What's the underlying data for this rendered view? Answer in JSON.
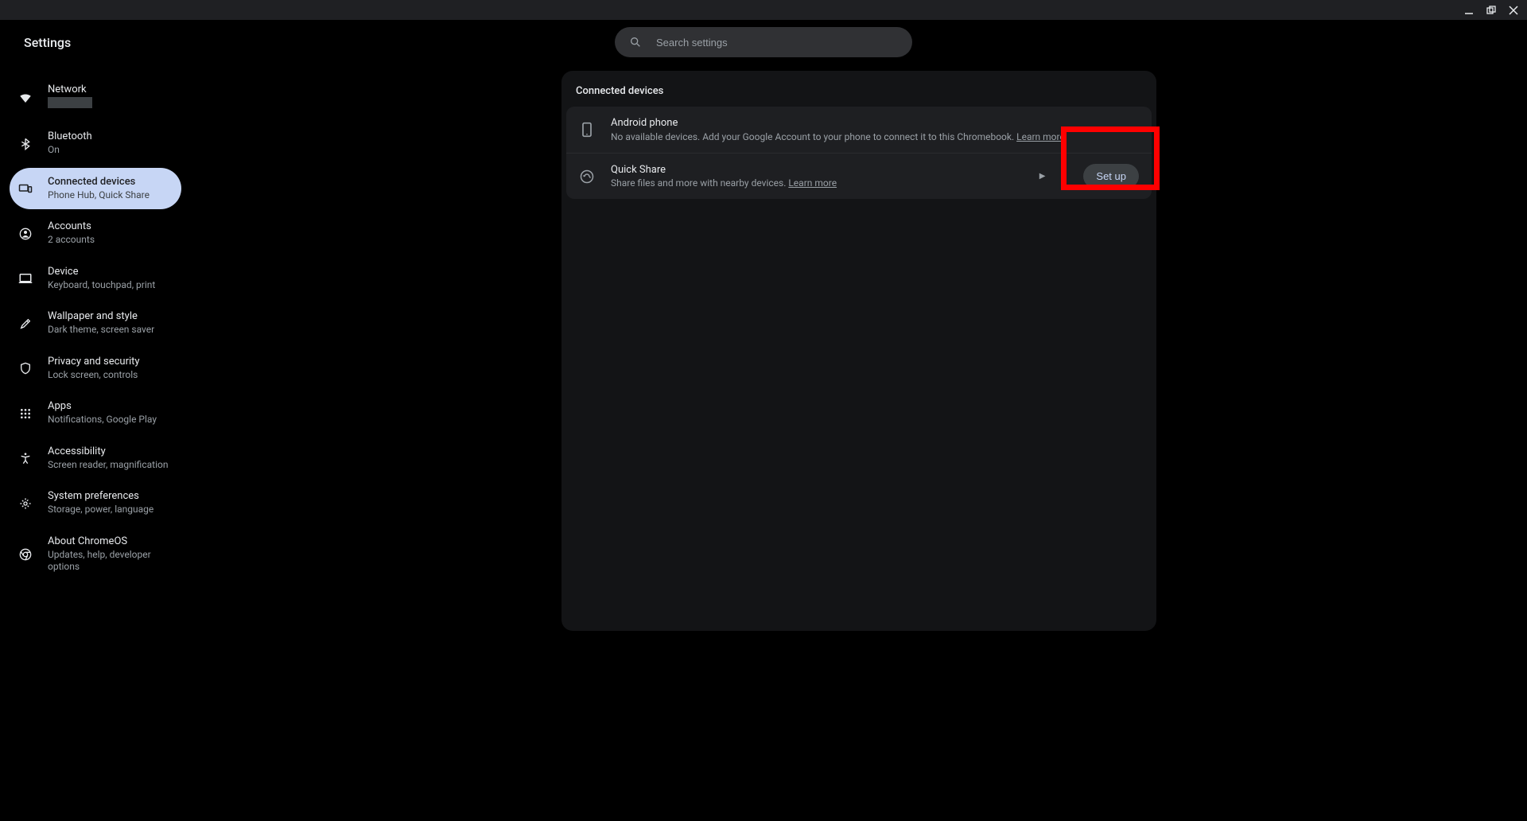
{
  "window": {
    "app_title": "Settings"
  },
  "search": {
    "placeholder": "Search settings"
  },
  "sidebar": {
    "items": [
      {
        "label": "Network",
        "sublabel": ""
      },
      {
        "label": "Bluetooth",
        "sublabel": "On"
      },
      {
        "label": "Connected devices",
        "sublabel": "Phone Hub, Quick Share"
      },
      {
        "label": "Accounts",
        "sublabel": "2 accounts"
      },
      {
        "label": "Device",
        "sublabel": "Keyboard, touchpad, print"
      },
      {
        "label": "Wallpaper and style",
        "sublabel": "Dark theme, screen saver"
      },
      {
        "label": "Privacy and security",
        "sublabel": "Lock screen, controls"
      },
      {
        "label": "Apps",
        "sublabel": "Notifications, Google Play"
      },
      {
        "label": "Accessibility",
        "sublabel": "Screen reader, magnification"
      },
      {
        "label": "System preferences",
        "sublabel": "Storage, power, language"
      },
      {
        "label": "About ChromeOS",
        "sublabel": "Updates, help, developer options"
      }
    ]
  },
  "main": {
    "section_title": "Connected devices",
    "android": {
      "title": "Android phone",
      "desc": "No available devices. Add your Google Account to your phone to connect it to this Chromebook. ",
      "learn_more": "Learn more"
    },
    "quickshare": {
      "title": "Quick Share",
      "desc": "Share files and more with nearby devices. ",
      "learn_more": "Learn more",
      "setup_label": "Set up"
    }
  }
}
